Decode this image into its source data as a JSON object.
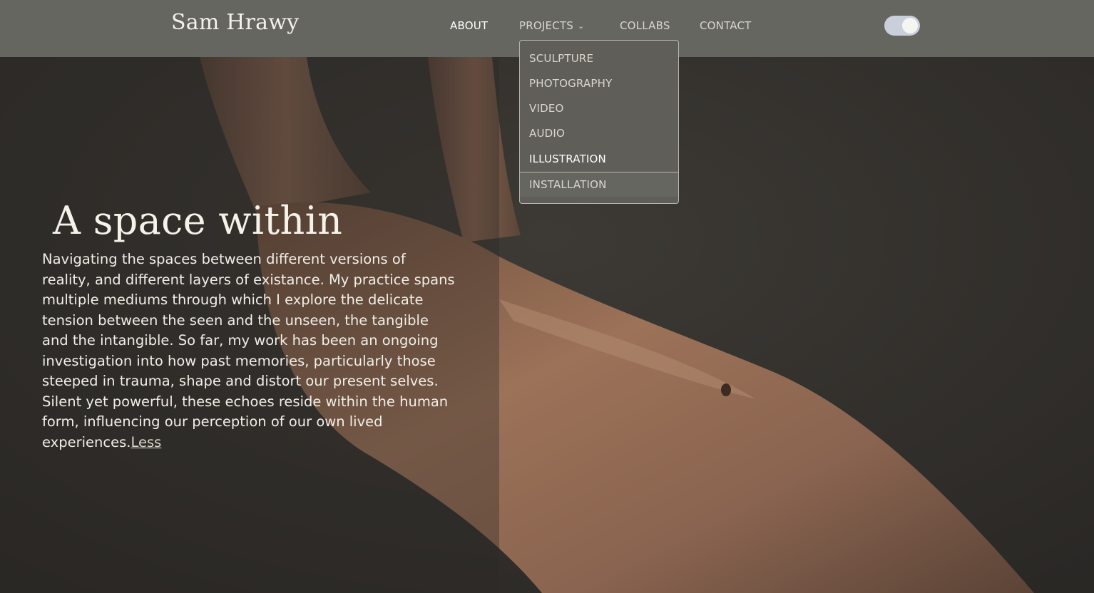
{
  "header": {
    "brand": "Sam Hrawy",
    "nav": {
      "about": "ABOUT",
      "projects": "PROJECTS",
      "collabs": "COLLABS",
      "contact": "CONTACT"
    },
    "theme_toggle": {
      "state": "on"
    }
  },
  "dropdown": {
    "items": [
      {
        "label": "SCULPTURE"
      },
      {
        "label": "PHOTOGRAPHY"
      },
      {
        "label": "VIDEO"
      },
      {
        "label": "AUDIO"
      },
      {
        "label": "ILLUSTRATION"
      },
      {
        "label": "INSTALLATION"
      }
    ]
  },
  "hero": {
    "title": "A space within",
    "description": "Navigating the spaces between different versions of reality, and different layers of existance. My practice spans multiple mediums through which I explore the delicate tension between the seen and the unseen, the tangible and the intangible. So far, my work has been an ongoing investigation into how past memories, particularly those steeped in trauma, shape and distort our present selves. Silent yet powerful, these echoes reside within the human form, influencing our perception of our own lived experiences.",
    "less_link": "Less"
  },
  "colors": {
    "header_bg": "#666660",
    "dropdown_bg": "#5f5e59",
    "toggle_track": "#c9cfdb",
    "background_dark": "#2f2d29",
    "skin_tone": "#9c7258"
  }
}
